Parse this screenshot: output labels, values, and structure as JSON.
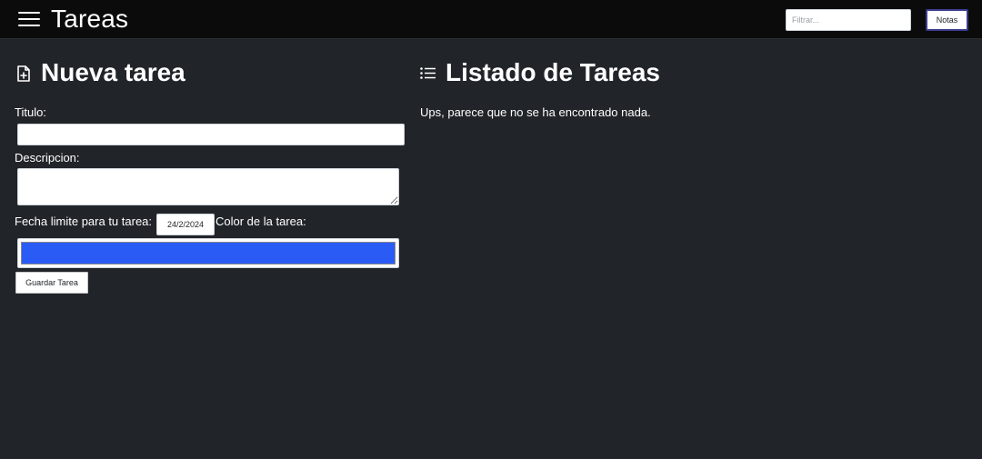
{
  "header": {
    "title": "Tareas",
    "filter_placeholder": "Filtrar...",
    "notes_button": "Notas"
  },
  "new_task": {
    "heading": "Nueva tarea",
    "title_label": "Titulo:",
    "title_value": "",
    "description_label": "Descripcion:",
    "description_value": "",
    "date_label": "Fecha limite para tu tarea:",
    "date_value": "24/2/2024",
    "color_label": "Color de la tarea:",
    "color_value": "#2a5cf5",
    "save_button": "Guardar Tarea"
  },
  "task_list": {
    "heading": "Listado de Tareas",
    "empty_message": "Ups, parece que no se ha encontrado nada."
  },
  "icons": {
    "menu": "hamburger-menu-icon",
    "new_task": "file-plus-icon",
    "list": "list-icon"
  },
  "colors": {
    "background": "#212529",
    "topbar": "#0b0b0b",
    "text": "#ffffff",
    "task_color": "#2a5cf5"
  }
}
